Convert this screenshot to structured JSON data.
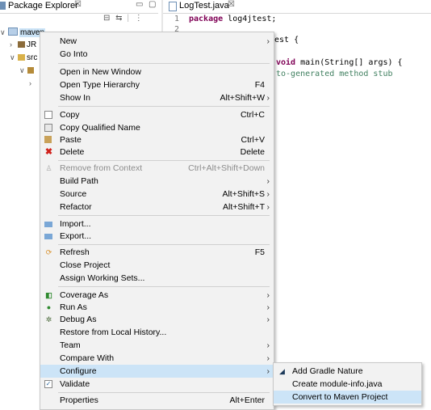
{
  "package_explorer": {
    "title": "Package Explorer",
    "close": "☒",
    "tree": [
      {
        "twisty": "∨",
        "label": "maven",
        "selected": true
      },
      {
        "twisty": "›",
        "label": "JR"
      },
      {
        "twisty": "∨",
        "label": "src"
      },
      {
        "twisty": "∨",
        "label": ""
      },
      {
        "twisty": "›",
        "label": ""
      }
    ]
  },
  "editor": {
    "tab_label": "LogTest.java",
    "tab_close": "☒",
    "lines": [
      {
        "num": "1",
        "kw": "package",
        "text": " log4jtest;"
      },
      {
        "num": "2",
        "kw": "",
        "text": ""
      }
    ],
    "frag_class": "est {",
    "frag_void_kw": "void",
    "frag_void_rest": " main(String[] args) {",
    "frag_comment": "to-generated method stub"
  },
  "context_menu": {
    "items": [
      {
        "label": "New",
        "shortcut": "",
        "submenu": true
      },
      {
        "label": "Go Into",
        "shortcut": "",
        "submenu": false
      },
      {
        "label": "Open in New Window",
        "shortcut": "",
        "submenu": false
      },
      {
        "label": "Open Type Hierarchy",
        "shortcut": "F4",
        "submenu": false
      },
      {
        "label": "Show In",
        "shortcut": "Alt+Shift+W",
        "submenu": true
      },
      {
        "label": "Copy",
        "shortcut": "Ctrl+C",
        "submenu": false,
        "icon": "copy-icon"
      },
      {
        "label": "Copy Qualified Name",
        "shortcut": "",
        "submenu": false,
        "icon": "copy-qualified-icon"
      },
      {
        "label": "Paste",
        "shortcut": "Ctrl+V",
        "submenu": false,
        "icon": "paste-icon"
      },
      {
        "label": "Delete",
        "shortcut": "Delete",
        "submenu": false,
        "icon": "delete-icon"
      },
      {
        "label": "Remove from Context",
        "shortcut": "Ctrl+Alt+Shift+Down",
        "submenu": false,
        "disabled": true,
        "icon": "remove-context-icon"
      },
      {
        "label": "Build Path",
        "shortcut": "",
        "submenu": true
      },
      {
        "label": "Source",
        "shortcut": "Alt+Shift+S",
        "submenu": true
      },
      {
        "label": "Refactor",
        "shortcut": "Alt+Shift+T",
        "submenu": true
      },
      {
        "label": "Import...",
        "shortcut": "",
        "submenu": false,
        "icon": "import-icon"
      },
      {
        "label": "Export...",
        "shortcut": "",
        "submenu": false,
        "icon": "export-icon"
      },
      {
        "label": "Refresh",
        "shortcut": "F5",
        "submenu": false,
        "icon": "refresh-icon"
      },
      {
        "label": "Close Project",
        "shortcut": "",
        "submenu": false
      },
      {
        "label": "Assign Working Sets...",
        "shortcut": "",
        "submenu": false
      },
      {
        "label": "Coverage As",
        "shortcut": "",
        "submenu": true,
        "icon": "coverage-icon"
      },
      {
        "label": "Run As",
        "shortcut": "",
        "submenu": true,
        "icon": "run-icon"
      },
      {
        "label": "Debug As",
        "shortcut": "",
        "submenu": true,
        "icon": "debug-icon"
      },
      {
        "label": "Restore from Local History...",
        "shortcut": "",
        "submenu": false
      },
      {
        "label": "Team",
        "shortcut": "",
        "submenu": true
      },
      {
        "label": "Compare With",
        "shortcut": "",
        "submenu": true
      },
      {
        "label": "Configure",
        "shortcut": "",
        "submenu": true,
        "selected": true
      },
      {
        "label": "Validate",
        "shortcut": "",
        "submenu": false,
        "icon": "validate-icon"
      },
      {
        "label": "Properties",
        "shortcut": "Alt+Enter",
        "submenu": false
      }
    ]
  },
  "configure_submenu": {
    "items": [
      {
        "label": "Add Gradle Nature",
        "icon": "gradle-icon"
      },
      {
        "label": "Create module-info.java"
      },
      {
        "label": "Convert to Maven Project",
        "selected": true
      }
    ]
  },
  "colors": {
    "selection": "#cce4f7",
    "menu_bg": "#f2f2f2",
    "keyword": "#7f0055",
    "comment": "#3f7f5f"
  }
}
